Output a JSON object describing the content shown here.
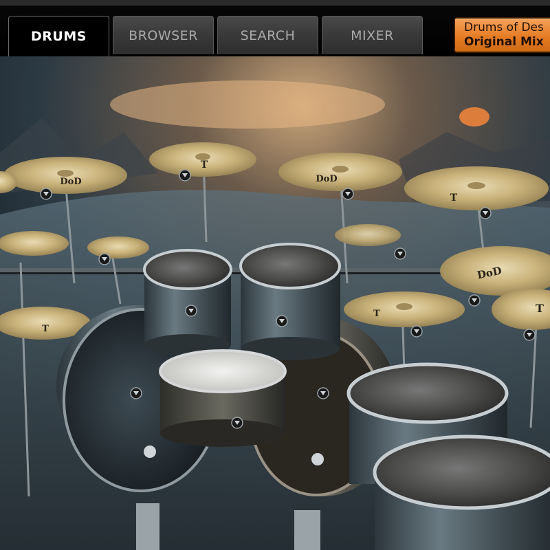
{
  "tabs": [
    {
      "label": "DRUMS",
      "active": true
    },
    {
      "label": "BROWSER",
      "active": false
    },
    {
      "label": "SEARCH",
      "active": false
    },
    {
      "label": "MIXER",
      "active": false
    }
  ],
  "preset": {
    "line1": "Drums of Des",
    "line2": "Original Mix"
  },
  "cymbal_logos": {
    "dod": "DoD",
    "t": "T"
  },
  "icons": {
    "drum_menu": "triangle-down-icon"
  },
  "colors": {
    "accent_orange": "#e57c25",
    "tab_active_bg": "#000000",
    "tab_inactive_bg": "#3a3a3a",
    "cymbal_gold": "#c9b27a",
    "drum_shell": "#4e5a60"
  }
}
